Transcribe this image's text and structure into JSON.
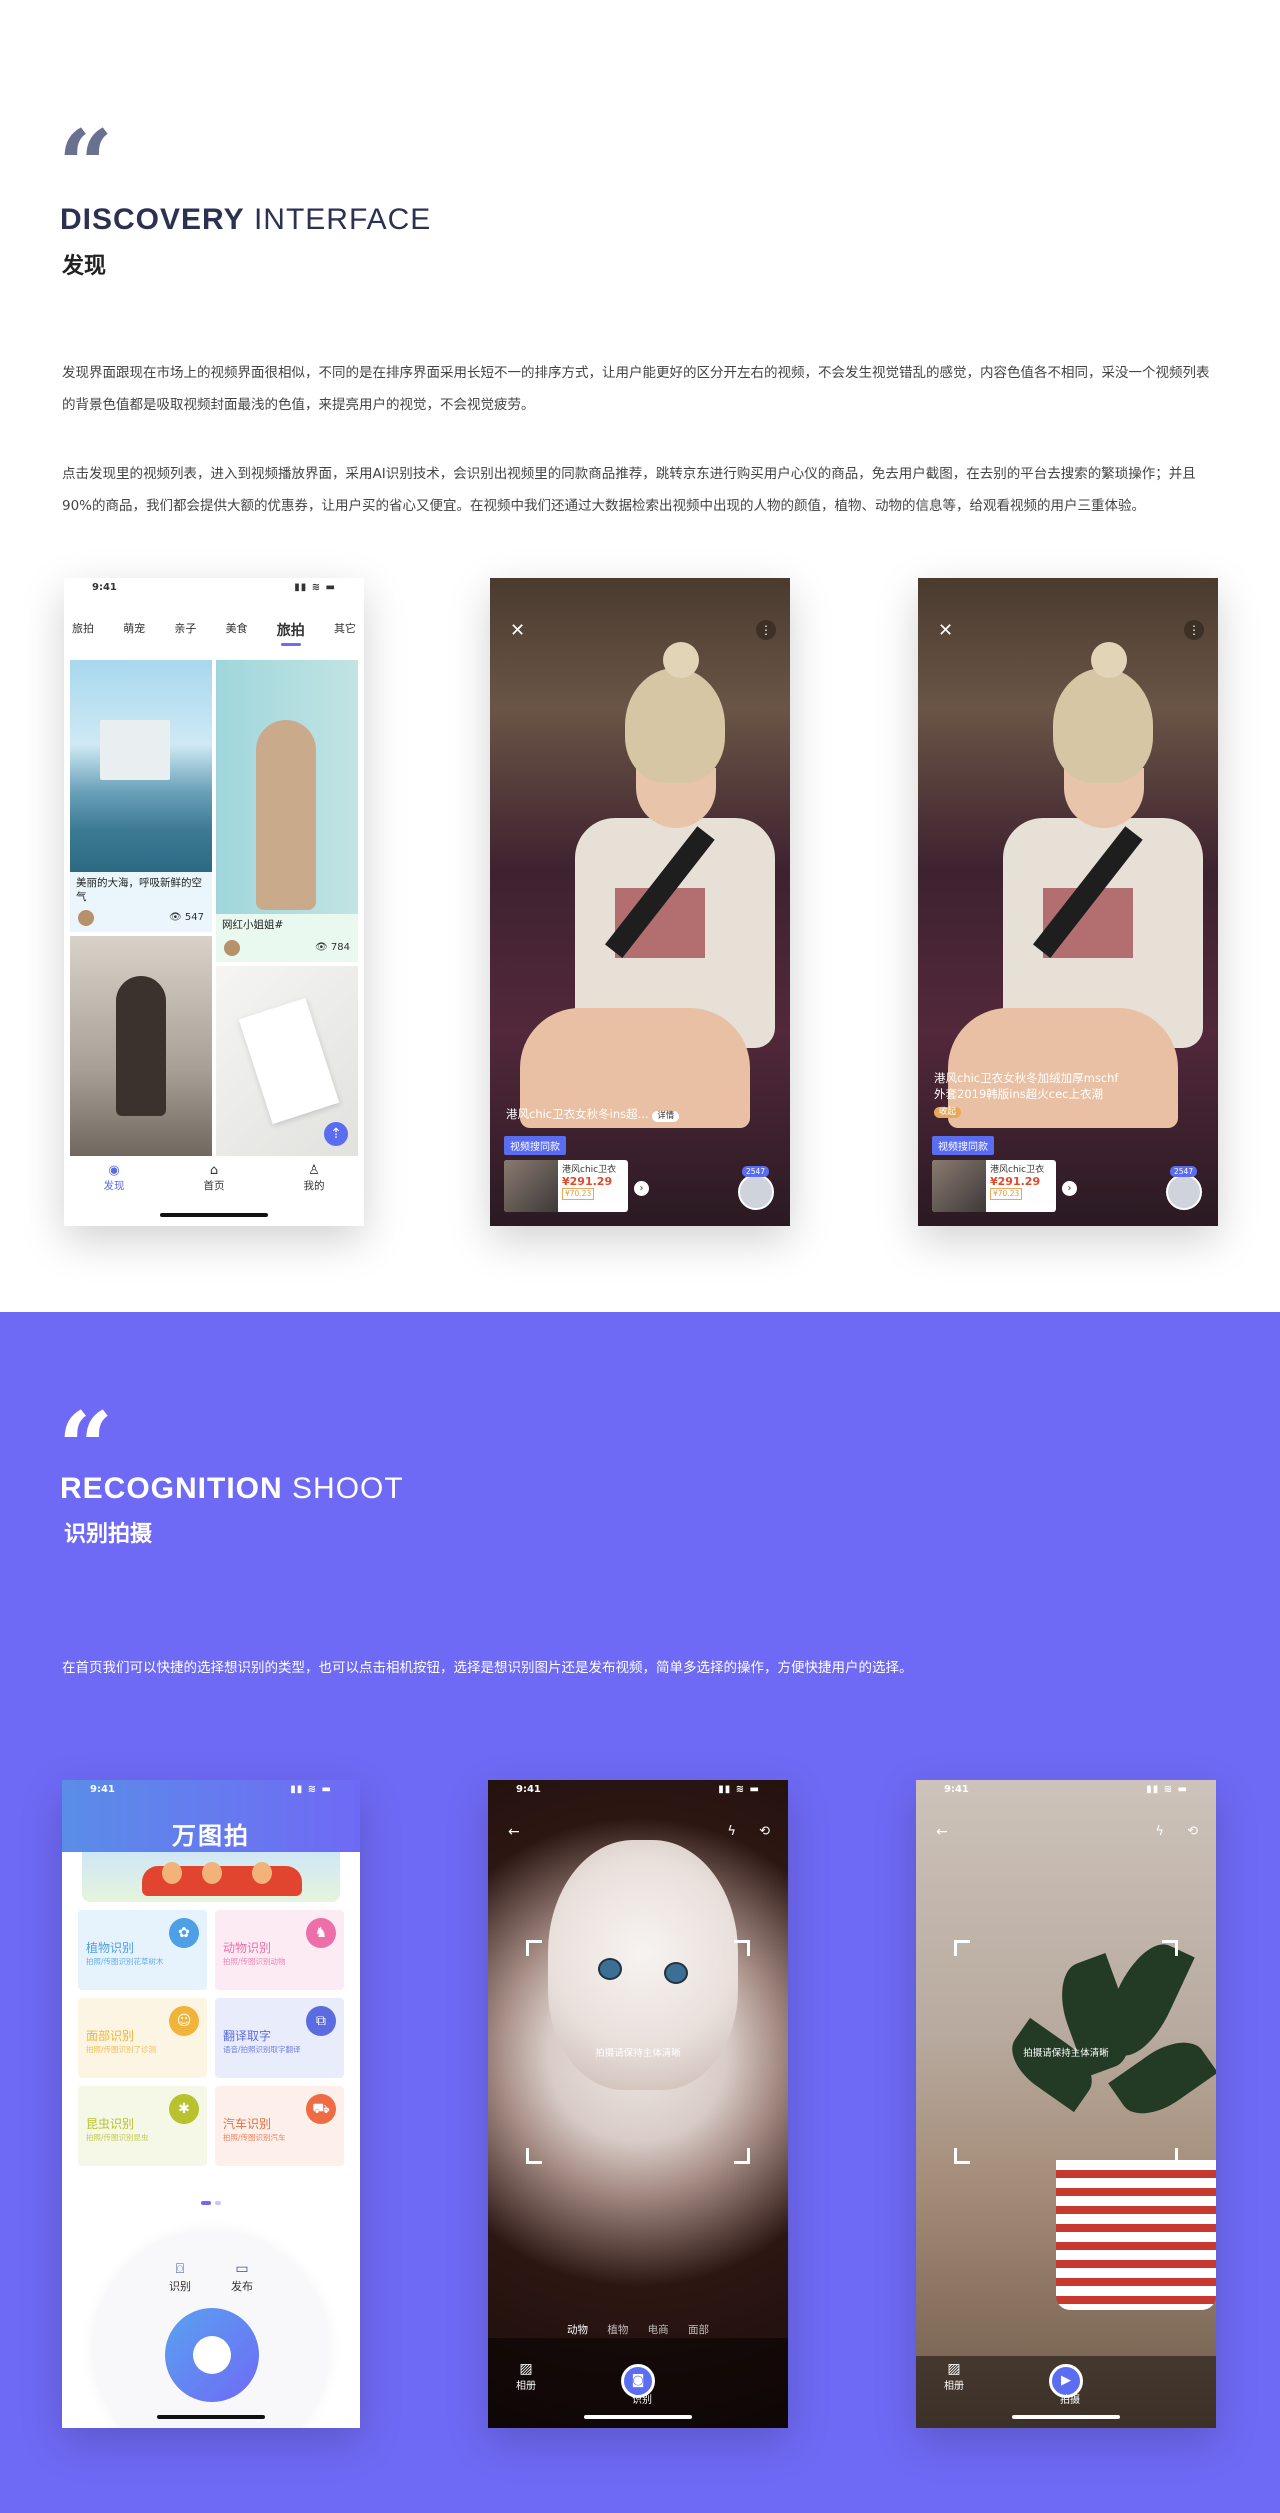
{
  "colors": {
    "accent": "#6f6af5",
    "quote": "#6a7190"
  },
  "discovery": {
    "quote_mark": "66",
    "title_bold": "DISCOVERY",
    "title_light": "INTERFACE",
    "title_cn": "发现",
    "para1": "发现界面跟现在市场上的视频界面很相似，不同的是在排序界面采用长短不一的排序方式，让用户能更好的区分开左右的视频，不会发生视觉错乱的感觉，内容色值各不相同，采没一个视频列表的背景色值都是吸取视频封面最浅的色值，来提亮用户的视觉，不会视觉疲劳。",
    "para2": "点击发现里的视频列表，进入到视频播放界面，采用AI识别技术，会识别出视频里的同款商品推荐，跳转京东进行购买用户心仪的商品，免去用户截图，在去别的平台去搜索的繁琐操作；并且90%的商品，我们都会提供大额的优惠券，让用户买的省心又便宜。在视频中我们还通过大数据检索出视频中出现的人物的颜值，植物、动物的信息等，给观看视频的用户三重体验。"
  },
  "phone_list": {
    "time": "9:41",
    "tabs": [
      "旅拍",
      "萌宠",
      "亲子",
      "美食",
      "旅拍",
      "其它"
    ],
    "cards": [
      {
        "caption": "美丽的大海，呼吸新鲜的空气",
        "views": "547"
      },
      {
        "caption": "网红小姐姐#",
        "views": "784"
      }
    ],
    "nav": [
      "发现",
      "首页",
      "我的"
    ]
  },
  "video1": {
    "title": "港风chic卫衣女秋冬ins超...",
    "tag": "详情",
    "badge": "视频搜同款",
    "product_name": "港风chic卫衣",
    "price": "¥291.29",
    "coupon": "¥70.23",
    "likes": "2547"
  },
  "video2": {
    "title": "港风chic卫衣女秋冬加绒加厚mschf外套2019韩版ins超火cec上衣潮",
    "tag": "收起",
    "badge": "视频搜同款",
    "product_name": "港风chic卫衣",
    "price": "¥291.29",
    "coupon": "¥70.23",
    "likes": "2547"
  },
  "recognition": {
    "quote_mark": "66",
    "title_bold": "RECOGNITION",
    "title_light": "SHOOT",
    "title_cn": "识别拍摄",
    "para": "在首页我们可以快捷的选择想识别的类型，也可以点击相机按钮，选择是想识别图片还是发布视频，简单多选择的操作，方便快捷用户的选择。"
  },
  "phone_home": {
    "time": "9:41",
    "brand": "万图拍",
    "tiles": [
      {
        "title": "植物识别",
        "sub": "拍照/传图识别花草树木",
        "bg": "#e6f3fd",
        "fg": "#4d9fe6",
        "icon": "✿"
      },
      {
        "title": "动物识别",
        "sub": "拍照/传图识别动物",
        "bg": "#fdebf4",
        "fg": "#ec6fa9",
        "icon": "♞"
      },
      {
        "title": "面部识别",
        "sub": "拍照/传图识别了诊测",
        "bg": "#fdf5e4",
        "fg": "#f0b43a",
        "icon": "☺"
      },
      {
        "title": "翻译取字",
        "sub": "语音/拍照识别取字翻译",
        "bg": "#e9ecfb",
        "fg": "#5b6be0",
        "icon": "⧉"
      },
      {
        "title": "昆虫识别",
        "sub": "拍照/传图识别昆虫",
        "bg": "#f5f8e6",
        "fg": "#b8c22e",
        "icon": "✱"
      },
      {
        "title": "汽车识别",
        "sub": "拍照/传图识别汽车",
        "bg": "#fdefe9",
        "fg": "#ef6b43",
        "icon": "⛟"
      }
    ],
    "options": [
      "识别",
      "发布"
    ]
  },
  "camera1": {
    "time": "9:41",
    "hint": "拍摄请保持主体清晰",
    "tabs": [
      "动物",
      "植物",
      "电商",
      "面部"
    ],
    "album": "相册",
    "shoot": "识别"
  },
  "camera2": {
    "time": "9:41",
    "hint": "拍摄请保持主体清晰",
    "album": "相册",
    "shoot": "拍摄"
  }
}
